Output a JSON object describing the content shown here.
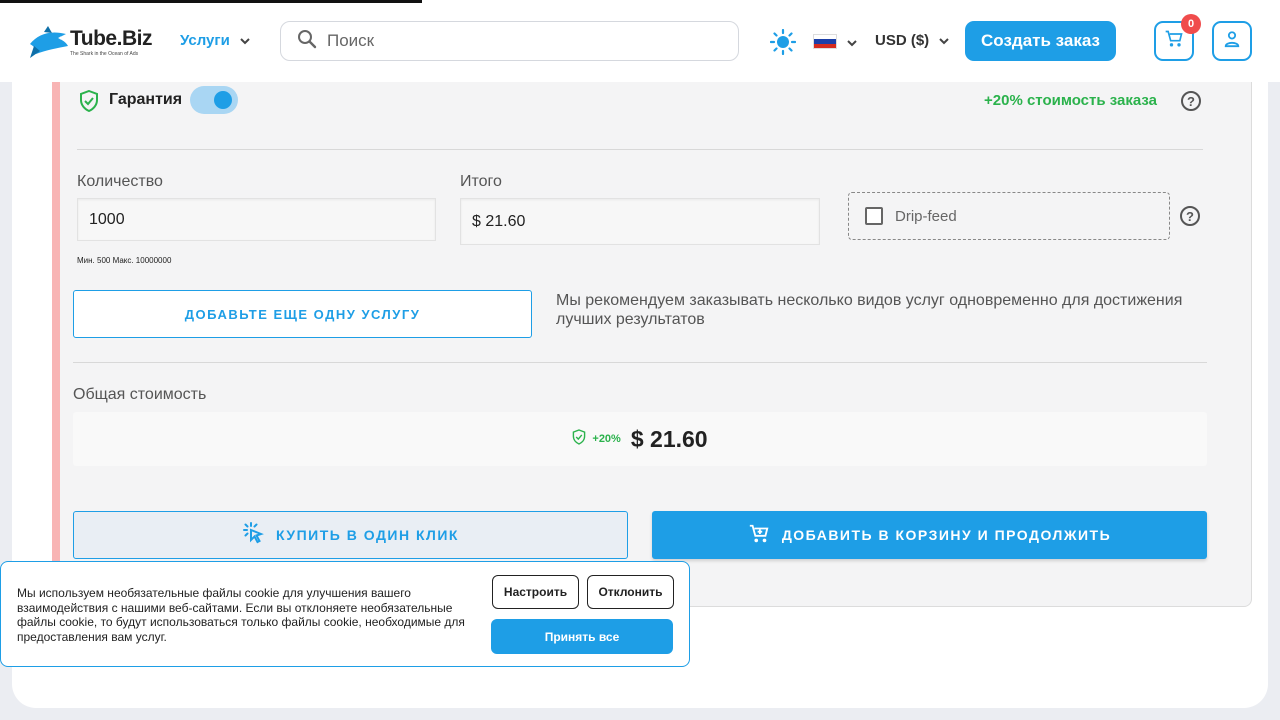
{
  "header": {
    "logo_text_main": "Tube",
    "logo_text_dot": ".Biz",
    "logo_tagline": "The Shark in the Ocean of Ads",
    "services_label": "Услуги",
    "search_placeholder": "Поиск",
    "currency": "USD ($)",
    "create_order": "Создать заказ",
    "cart_count": "0",
    "accent": "#1e9ee6"
  },
  "order": {
    "guarantee_label": "Гарантия",
    "guarantee_enabled": true,
    "guarantee_markup": "+20% стоимость заказа",
    "quantity_label": "Количество",
    "quantity_value": "1000",
    "limits": "Мин. 500 Макс. 10000000",
    "total_label": "Итого",
    "total_value": "$ 21.60",
    "dripfeed_label": "Drip-feed",
    "add_service": "ДОБАВЬТЕ ЕЩЕ ОДНУ УСЛУГУ",
    "recommend_text": "Мы рекомендуем заказывать несколько видов услуг одновременно для достижения лучших результатов",
    "grand_total_label": "Общая стоимость",
    "grand_total_pct": "+20%",
    "grand_total_value": "$ 21.60",
    "buy_one_click": "КУПИТЬ В ОДИН КЛИК",
    "add_to_cart": "ДОБАВИТЬ В КОРЗИНУ И ПРОДОЛЖИТЬ"
  },
  "cookie": {
    "text": "Мы используем необязательные файлы cookie для улучшения вашего взаимодействия с нашими веб-сайтами. Если вы отклоняете необязательные файлы cookie, то будут использоваться только файлы cookie, необходимые для предоставления вам услуг.",
    "configure": "Настроить",
    "decline": "Отклонить",
    "accept_all": "Принять все"
  }
}
